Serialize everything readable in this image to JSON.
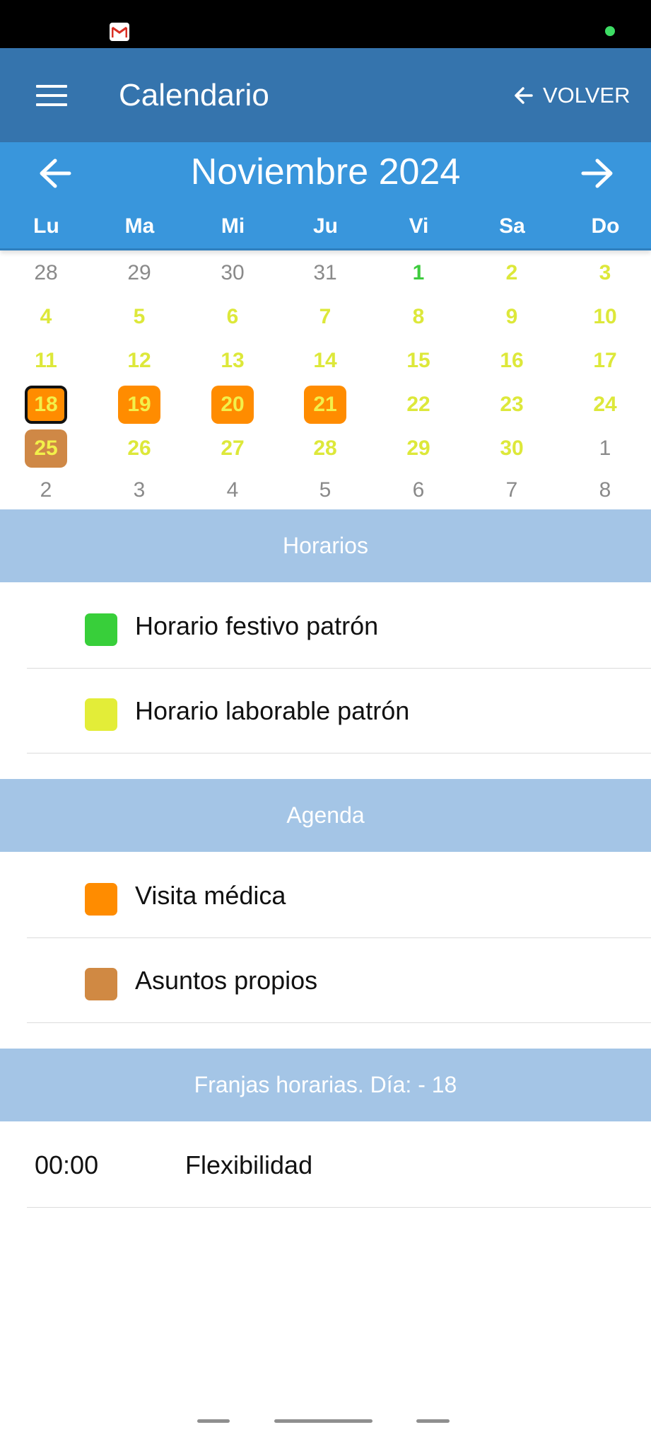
{
  "status_bar": {
    "notification_icon": "gmail-icon",
    "indicator_color": "#3ddc64"
  },
  "app_bar": {
    "title": "Calendario",
    "back_label": "VOLVER",
    "menu_icon": "menu-icon",
    "background": "#3574ad"
  },
  "calendar": {
    "month_label": "Noviembre 2024",
    "prev_icon": "arrow-left-icon",
    "next_icon": "arrow-right-icon",
    "weekdays": [
      "Lu",
      "Ma",
      "Mi",
      "Ju",
      "Vi",
      "Sa",
      "Do"
    ],
    "selected_day": "18",
    "weeks": [
      [
        {
          "day": "28",
          "type": "muted"
        },
        {
          "day": "29",
          "type": "muted"
        },
        {
          "day": "30",
          "type": "muted"
        },
        {
          "day": "31",
          "type": "muted"
        },
        {
          "day": "1",
          "type": "holiday"
        },
        {
          "day": "2",
          "type": "work"
        },
        {
          "day": "3",
          "type": "work"
        }
      ],
      [
        {
          "day": "4",
          "type": "work"
        },
        {
          "day": "5",
          "type": "work"
        },
        {
          "day": "6",
          "type": "work"
        },
        {
          "day": "7",
          "type": "work"
        },
        {
          "day": "8",
          "type": "work"
        },
        {
          "day": "9",
          "type": "work"
        },
        {
          "day": "10",
          "type": "work"
        }
      ],
      [
        {
          "day": "11",
          "type": "work"
        },
        {
          "day": "12",
          "type": "work"
        },
        {
          "day": "13",
          "type": "work"
        },
        {
          "day": "14",
          "type": "work"
        },
        {
          "day": "15",
          "type": "work"
        },
        {
          "day": "16",
          "type": "work"
        },
        {
          "day": "17",
          "type": "work"
        }
      ],
      [
        {
          "day": "18",
          "type": "visit",
          "selected": true
        },
        {
          "day": "19",
          "type": "visit"
        },
        {
          "day": "20",
          "type": "visit"
        },
        {
          "day": "21",
          "type": "visit"
        },
        {
          "day": "22",
          "type": "work"
        },
        {
          "day": "23",
          "type": "work"
        },
        {
          "day": "24",
          "type": "work"
        }
      ],
      [
        {
          "day": "25",
          "type": "own"
        },
        {
          "day": "26",
          "type": "work"
        },
        {
          "day": "27",
          "type": "work"
        },
        {
          "day": "28",
          "type": "work"
        },
        {
          "day": "29",
          "type": "work"
        },
        {
          "day": "30",
          "type": "work"
        },
        {
          "day": "1",
          "type": "muted"
        }
      ],
      [
        {
          "day": "2",
          "type": "muted"
        },
        {
          "day": "3",
          "type": "muted"
        },
        {
          "day": "4",
          "type": "muted"
        },
        {
          "day": "5",
          "type": "muted"
        },
        {
          "day": "6",
          "type": "muted"
        },
        {
          "day": "7",
          "type": "muted"
        },
        {
          "day": "8",
          "type": "muted"
        }
      ]
    ]
  },
  "horarios": {
    "title": "Horarios",
    "items": [
      {
        "label": "Horario festivo patrón",
        "color": "#38cf3a"
      },
      {
        "label": "Horario laborable patrón",
        "color": "#e3ed38"
      }
    ]
  },
  "agenda": {
    "title": "Agenda",
    "items": [
      {
        "label": "Visita médica",
        "color": "#ff8c00"
      },
      {
        "label": "Asuntos propios",
        "color": "#d08943"
      }
    ]
  },
  "franjas": {
    "title": "Franjas horarias. Día: - 18",
    "rows": [
      {
        "time": "00:00",
        "label": "Flexibilidad"
      }
    ]
  }
}
